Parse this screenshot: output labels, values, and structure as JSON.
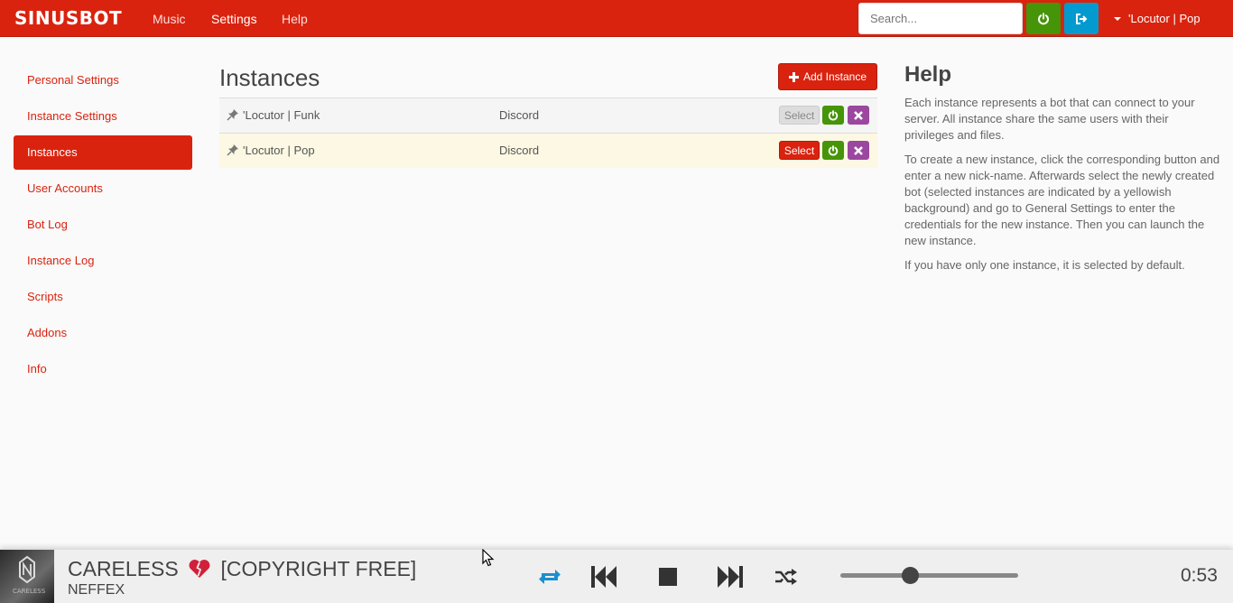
{
  "navbar": {
    "brand": "SINUSBOT",
    "links": [
      "Music",
      "Settings",
      "Help"
    ],
    "active_link": "Settings",
    "search_placeholder": "Search...",
    "current_instance": "'Locutor | Pop"
  },
  "sidebar": {
    "items": [
      {
        "label": "Personal Settings"
      },
      {
        "label": "Instance Settings"
      },
      {
        "label": "Instances",
        "active": true
      },
      {
        "label": "User Accounts"
      },
      {
        "label": "Bot Log"
      },
      {
        "label": "Instance Log"
      },
      {
        "label": "Scripts"
      },
      {
        "label": "Addons"
      },
      {
        "label": "Info"
      }
    ]
  },
  "main": {
    "title": "Instances",
    "add_button_label": "Add Instance",
    "instances": [
      {
        "name": "'Locutor | Funk",
        "type": "Discord",
        "select_label": "Select",
        "selected": false
      },
      {
        "name": "'Locutor | Pop",
        "type": "Discord",
        "select_label": "Select",
        "selected": true
      }
    ]
  },
  "help": {
    "title": "Help",
    "paragraphs": [
      "Each instance represents a bot that can connect to your server. All instance share the same users with their privileges and files.",
      "To create a new instance, click the corresponding button and enter a new nick-name. Afterwards select the newly created bot (selected instances are indicated by a yellowish background) and go to General Settings to enter the credentials for the new instance. Then you can launch the new instance.",
      "If you have only one instance, it is selected by default."
    ]
  },
  "player": {
    "title_part1": "CARELESS",
    "title_part2": "[COPYRIGHT FREE]",
    "artist": "NEFFEX",
    "cover_text": "CARELESS",
    "time": "0:53",
    "volume_fraction": 0.39
  },
  "colors": {
    "primary": "#d9230f",
    "success": "#469408",
    "info": "#029acf",
    "danger": "#9b479f",
    "selected_row": "#fcf8e3"
  }
}
